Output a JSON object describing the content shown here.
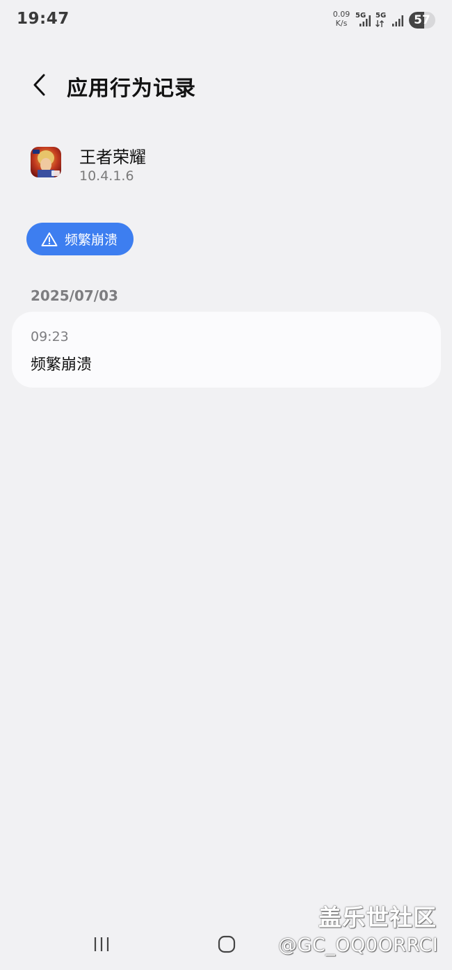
{
  "status_bar": {
    "time": "19:47",
    "net_speed_value": "0.09",
    "net_speed_unit": "K/s",
    "sim1_label": "5G",
    "sim2_label": "5G",
    "battery_level": "57",
    "battery_fraction": 0.57
  },
  "header": {
    "back_icon": "chevron-left-icon",
    "title": "应用行为记录"
  },
  "app": {
    "icon": "app-icon",
    "name": "王者荣耀",
    "version": "10.4.1.6"
  },
  "filter_chip": {
    "icon": "warning-triangle-icon",
    "label": "频繁崩溃",
    "color": "#3d7ef0"
  },
  "records": {
    "date": "2025/07/03",
    "items": [
      {
        "time": "09:23",
        "description": "频繁崩溃"
      }
    ]
  },
  "nav_bar": {
    "recent_icon": "recent-apps-icon",
    "home_icon": "home-icon"
  },
  "watermark": {
    "title": "盖乐世社区",
    "user": "@GC_OQ0ORRCI"
  }
}
